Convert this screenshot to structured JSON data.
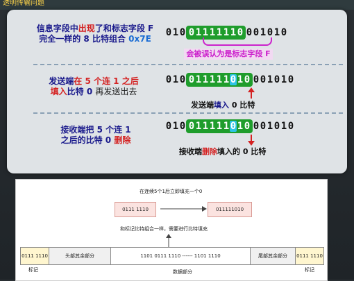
{
  "top_title": "透明传输问题",
  "rows": [
    {
      "label_parts": [
        "信息字段中",
        "出现",
        "了和标志字段 F",
        "完全一样的 8 比特组合 ",
        "0x7E"
      ],
      "bits_before": [
        "0",
        "1",
        "0"
      ],
      "bits_box": [
        "0",
        "1",
        "1",
        "1",
        "1",
        "1",
        "1",
        "0"
      ],
      "bits_after": [
        "0",
        "0",
        "1",
        "0",
        "1",
        "0"
      ],
      "note": "会被误认为是标志字段 F"
    },
    {
      "label_parts": [
        "发送端",
        "在 5 个连 1 之后",
        "填入",
        "比特 0 ",
        "再发送出去"
      ],
      "bits_before": [
        "0",
        "1",
        "0"
      ],
      "bits_box": [
        "0",
        "1",
        "1",
        "1",
        "1",
        "1",
        "0",
        "1",
        "0"
      ],
      "bits_after": [
        "0",
        "0",
        "1",
        "0",
        "1",
        "0"
      ],
      "highlight_index": 6,
      "note_parts": [
        "发送端",
        "填入",
        " 0 比特"
      ]
    },
    {
      "label_parts": [
        "接收端",
        "把 5 个连 1",
        "之后的比特 0 ",
        "删除"
      ],
      "bits_before": [
        "0",
        "1",
        "0"
      ],
      "bits_box": [
        "0",
        "1",
        "1",
        "1",
        "1",
        "1",
        "0",
        "1",
        "0"
      ],
      "bits_after": [
        "0",
        "0",
        "1",
        "0",
        "1",
        "0"
      ],
      "highlight_index": 6,
      "note_parts": [
        "接收端",
        "删除",
        "填入的 0 比特"
      ]
    }
  ],
  "diagram": {
    "caption_top": "在连续5个1后立即填充一个0",
    "box_left": "0111 1110",
    "box_right": "011111010",
    "caption_mid": "和标记比特组合一样，需要进行比特填充",
    "segments": [
      "0111 1110",
      "头部其余部分",
      "1101 0111 1110 ------ 1101 1110",
      "尾部其余部分",
      "0111 1110"
    ],
    "label_flag_left": "标记",
    "label_data": "数据部分",
    "label_flag_right": "标记"
  },
  "colors": {
    "accent_green": "#1f9d2c",
    "highlight_cyan": "#2ec4e6",
    "alert_red": "#d42222",
    "brace_magenta": "#cc22cc"
  }
}
